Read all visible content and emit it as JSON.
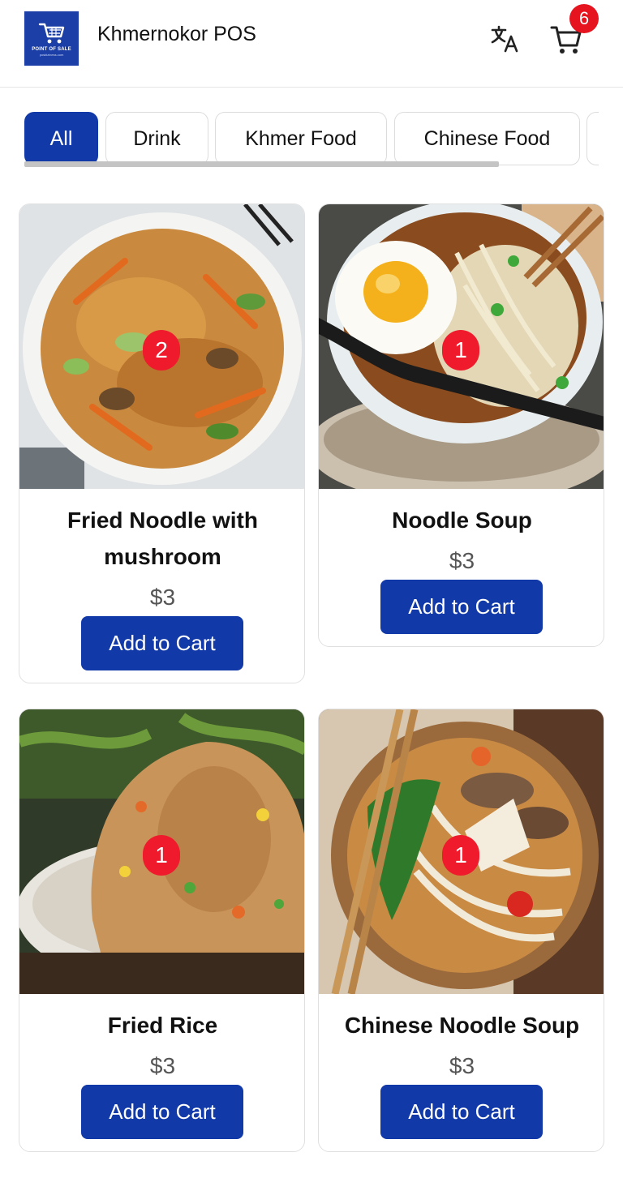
{
  "header": {
    "title": "Khmernokor POS",
    "logo_text": "POINT OF SALE",
    "logo_subtext": "posbiziness.com",
    "cart_count": "6"
  },
  "categories": [
    {
      "label": "All",
      "active": true
    },
    {
      "label": "Drink"
    },
    {
      "label": "Khmer Food"
    },
    {
      "label": "Chinese Food"
    }
  ],
  "products": [
    {
      "name": "Fried Noodle with mushroom",
      "price": "$3",
      "quantity": "2",
      "button": "Add to Cart"
    },
    {
      "name": "Noodle Soup",
      "price": "$3",
      "quantity": "1",
      "button": "Add to Cart"
    },
    {
      "name": "Fried Rice",
      "price": "$3",
      "quantity": "1",
      "button": "Add to Cart"
    },
    {
      "name": "Chinese Noodle Soup",
      "price": "$3",
      "quantity": "1",
      "button": "Add to Cart"
    }
  ],
  "colors": {
    "primary": "#1239a8",
    "badge": "#ef1b2d",
    "logo_bg": "#1b3fa6"
  },
  "icons": [
    "cart-logo-icon",
    "translate-icon",
    "shopping-cart-icon"
  ]
}
